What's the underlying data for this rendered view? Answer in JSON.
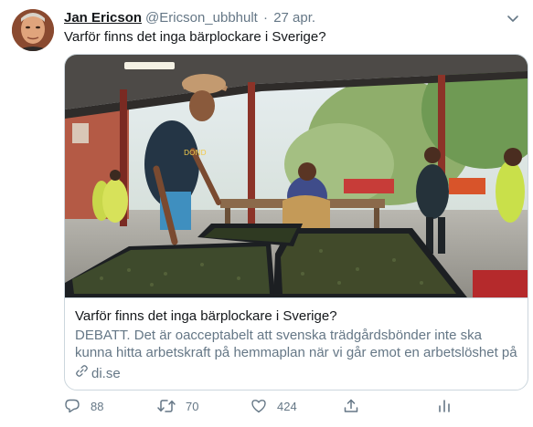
{
  "tweet": {
    "author_name": "Jan Ericson",
    "author_handle": "@Ericson_ubbhult",
    "separator": "·",
    "date": "27 apr.",
    "text": "Varför finns det inga bärplockare i Sverige?"
  },
  "card": {
    "title": "Varför finns det inga bärplockare i Sverige?",
    "description": "DEBATT. Det är oacceptabelt att svenska trädgårdsbönder inte ska kunna hitta arbetskraft på hemmaplan när vi går emot en arbetslöshet på nära...",
    "domain": "di.se"
  },
  "actions": {
    "reply_count": "88",
    "retweet_count": "70",
    "like_count": "424"
  },
  "icons": {
    "chevron": "chevron-down-icon",
    "link": "link-icon",
    "reply": "reply-icon",
    "retweet": "retweet-icon",
    "like": "heart-icon",
    "share": "share-icon",
    "analytics": "analytics-icon"
  },
  "colors": {
    "text": "#14171a",
    "secondary": "#657786",
    "border": "#ccd6dd"
  }
}
